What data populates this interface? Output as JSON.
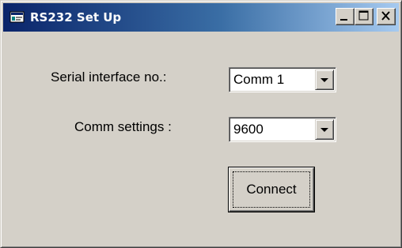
{
  "window": {
    "title": "RS232 Set Up",
    "title_icon": "app-window-icon",
    "caption_buttons": [
      "minimize-icon",
      "maximize-icon",
      "close-icon"
    ]
  },
  "form": {
    "serial_label": "Serial interface no.:",
    "serial_value": "Comm 1",
    "comm_label": "Comm settings :",
    "comm_value": "9600",
    "connect_label": "Connect"
  },
  "colors": {
    "title_gradient_start": "#0a246a",
    "title_gradient_end": "#a6caf0",
    "face": "#d4d0c8"
  }
}
